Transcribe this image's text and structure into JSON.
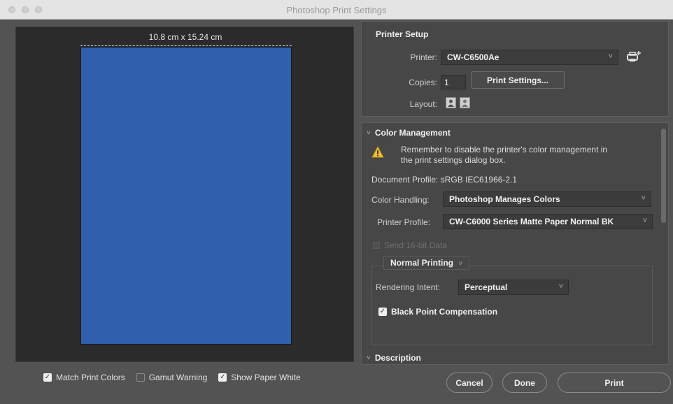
{
  "window": {
    "title": "Photoshop Print Settings"
  },
  "preview": {
    "dimensions": "10.8 cm x 15.24 cm",
    "paper_color": "#2f5fad"
  },
  "preview_options": {
    "match_print_colors": {
      "label": "Match Print Colors",
      "checked": true
    },
    "gamut_warning": {
      "label": "Gamut Warning",
      "checked": false
    },
    "show_paper_white": {
      "label": "Show Paper White",
      "checked": true
    }
  },
  "printer_setup": {
    "title": "Printer Setup",
    "printer_label": "Printer:",
    "printer_value": "CW-C6500Ae",
    "copies_label": "Copies:",
    "copies_value": "1",
    "print_settings_button": "Print Settings...",
    "layout_label": "Layout:",
    "layout_options": [
      "portrait-icon",
      "landscape-icon"
    ]
  },
  "color_management": {
    "title": "Color Management",
    "warning": "Remember to disable the printer's color management in the print settings dialog box.",
    "document_profile": "Document Profile: sRGB IEC61966-2.1",
    "color_handling_label": "Color Handling:",
    "color_handling_value": "Photoshop Manages Colors",
    "printer_profile_label": "Printer Profile:",
    "printer_profile_value": "CW-C6000 Series Matte Paper Normal BK",
    "send_16bit_label": "Send 16-bit Data",
    "normal_printing_label": "Normal Printing",
    "rendering_intent_label": "Rendering Intent:",
    "rendering_intent_value": "Perceptual",
    "black_point_label": "Black Point Compensation",
    "black_point_checked": true
  },
  "description": {
    "title": "Description"
  },
  "buttons": {
    "cancel": "Cancel",
    "done": "Done",
    "print": "Print"
  },
  "icons": {
    "chevron": "˅",
    "check": "✓",
    "section_arrow": "˅"
  }
}
